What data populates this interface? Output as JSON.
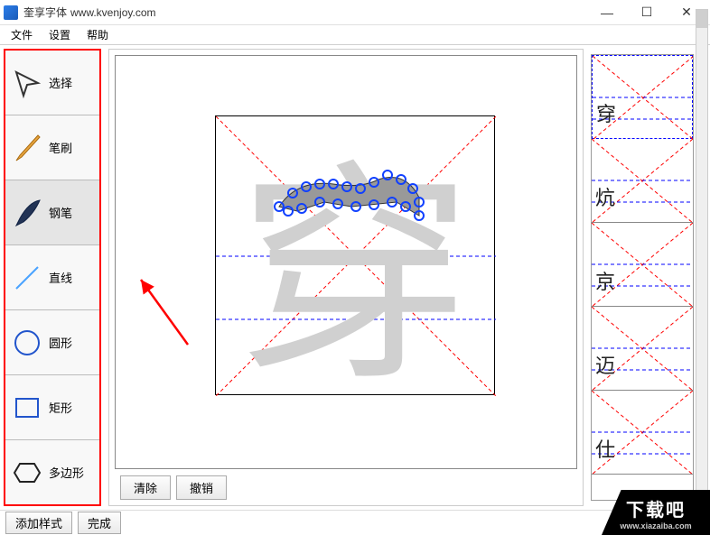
{
  "window": {
    "title": "奎享字体",
    "url": "www.kvenjoy.com"
  },
  "menu": {
    "file": "文件",
    "settings": "设置",
    "help": "帮助"
  },
  "tools": {
    "select": "选择",
    "brush": "笔刷",
    "pen": "钢笔",
    "line": "直线",
    "circle": "圆形",
    "rect": "矩形",
    "polygon": "多边形"
  },
  "canvas": {
    "current_char": "穿",
    "clear_label": "清除",
    "undo_label": "撤销"
  },
  "glyph_list": [
    "穿",
    "炕",
    "京",
    "迈",
    "仕"
  ],
  "bottom": {
    "add_style": "添加样式",
    "finish": "完成"
  },
  "watermark": {
    "site_cn": "下载吧",
    "site_url": "www.xiazaiba.com"
  }
}
